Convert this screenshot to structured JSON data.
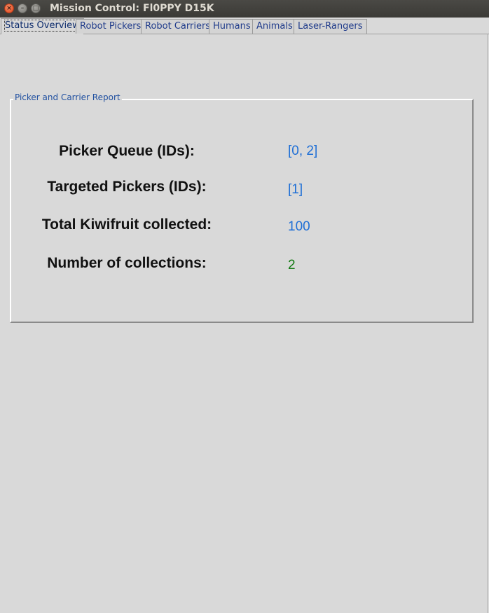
{
  "window": {
    "title": "Mission Control: Fl0PPY D15K",
    "close_glyph": "×",
    "minimize_glyph": "–",
    "maximize_glyph": "□"
  },
  "tabs": [
    {
      "label": "Status Overview",
      "active": true
    },
    {
      "label": "Robot Pickers",
      "active": false
    },
    {
      "label": "Robot Carriers",
      "active": false
    },
    {
      "label": "Humans",
      "active": false
    },
    {
      "label": "Animals",
      "active": false
    },
    {
      "label": "Laser-Rangers",
      "active": false
    }
  ],
  "report": {
    "title": "Picker and Carrier Report",
    "rows": [
      {
        "label": "Picker Queue (IDs):",
        "value": "[0, 2]",
        "value_color": "#1f6fd6"
      },
      {
        "label": "Targeted Pickers (IDs):",
        "value": "[1]",
        "value_color": "#1f6fd6"
      },
      {
        "label": "Total Kiwifruit collected:",
        "value": "100",
        "value_color": "#1f6fd6"
      },
      {
        "label": "Number of collections:",
        "value": "2",
        "value_color": "#137a13"
      }
    ]
  }
}
